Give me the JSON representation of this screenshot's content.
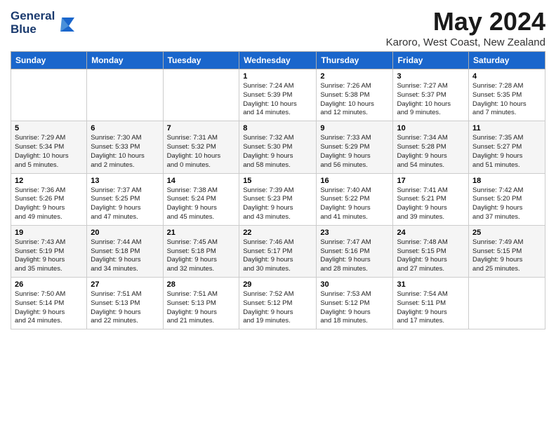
{
  "header": {
    "logo_line1": "General",
    "logo_line2": "Blue",
    "month_title": "May 2024",
    "location": "Karoro, West Coast, New Zealand"
  },
  "days_of_week": [
    "Sunday",
    "Monday",
    "Tuesday",
    "Wednesday",
    "Thursday",
    "Friday",
    "Saturday"
  ],
  "weeks": [
    [
      {
        "day": "",
        "info": ""
      },
      {
        "day": "",
        "info": ""
      },
      {
        "day": "",
        "info": ""
      },
      {
        "day": "1",
        "info": "Sunrise: 7:24 AM\nSunset: 5:39 PM\nDaylight: 10 hours\nand 14 minutes."
      },
      {
        "day": "2",
        "info": "Sunrise: 7:26 AM\nSunset: 5:38 PM\nDaylight: 10 hours\nand 12 minutes."
      },
      {
        "day": "3",
        "info": "Sunrise: 7:27 AM\nSunset: 5:37 PM\nDaylight: 10 hours\nand 9 minutes."
      },
      {
        "day": "4",
        "info": "Sunrise: 7:28 AM\nSunset: 5:35 PM\nDaylight: 10 hours\nand 7 minutes."
      }
    ],
    [
      {
        "day": "5",
        "info": "Sunrise: 7:29 AM\nSunset: 5:34 PM\nDaylight: 10 hours\nand 5 minutes."
      },
      {
        "day": "6",
        "info": "Sunrise: 7:30 AM\nSunset: 5:33 PM\nDaylight: 10 hours\nand 2 minutes."
      },
      {
        "day": "7",
        "info": "Sunrise: 7:31 AM\nSunset: 5:32 PM\nDaylight: 10 hours\nand 0 minutes."
      },
      {
        "day": "8",
        "info": "Sunrise: 7:32 AM\nSunset: 5:30 PM\nDaylight: 9 hours\nand 58 minutes."
      },
      {
        "day": "9",
        "info": "Sunrise: 7:33 AM\nSunset: 5:29 PM\nDaylight: 9 hours\nand 56 minutes."
      },
      {
        "day": "10",
        "info": "Sunrise: 7:34 AM\nSunset: 5:28 PM\nDaylight: 9 hours\nand 54 minutes."
      },
      {
        "day": "11",
        "info": "Sunrise: 7:35 AM\nSunset: 5:27 PM\nDaylight: 9 hours\nand 51 minutes."
      }
    ],
    [
      {
        "day": "12",
        "info": "Sunrise: 7:36 AM\nSunset: 5:26 PM\nDaylight: 9 hours\nand 49 minutes."
      },
      {
        "day": "13",
        "info": "Sunrise: 7:37 AM\nSunset: 5:25 PM\nDaylight: 9 hours\nand 47 minutes."
      },
      {
        "day": "14",
        "info": "Sunrise: 7:38 AM\nSunset: 5:24 PM\nDaylight: 9 hours\nand 45 minutes."
      },
      {
        "day": "15",
        "info": "Sunrise: 7:39 AM\nSunset: 5:23 PM\nDaylight: 9 hours\nand 43 minutes."
      },
      {
        "day": "16",
        "info": "Sunrise: 7:40 AM\nSunset: 5:22 PM\nDaylight: 9 hours\nand 41 minutes."
      },
      {
        "day": "17",
        "info": "Sunrise: 7:41 AM\nSunset: 5:21 PM\nDaylight: 9 hours\nand 39 minutes."
      },
      {
        "day": "18",
        "info": "Sunrise: 7:42 AM\nSunset: 5:20 PM\nDaylight: 9 hours\nand 37 minutes."
      }
    ],
    [
      {
        "day": "19",
        "info": "Sunrise: 7:43 AM\nSunset: 5:19 PM\nDaylight: 9 hours\nand 35 minutes."
      },
      {
        "day": "20",
        "info": "Sunrise: 7:44 AM\nSunset: 5:18 PM\nDaylight: 9 hours\nand 34 minutes."
      },
      {
        "day": "21",
        "info": "Sunrise: 7:45 AM\nSunset: 5:18 PM\nDaylight: 9 hours\nand 32 minutes."
      },
      {
        "day": "22",
        "info": "Sunrise: 7:46 AM\nSunset: 5:17 PM\nDaylight: 9 hours\nand 30 minutes."
      },
      {
        "day": "23",
        "info": "Sunrise: 7:47 AM\nSunset: 5:16 PM\nDaylight: 9 hours\nand 28 minutes."
      },
      {
        "day": "24",
        "info": "Sunrise: 7:48 AM\nSunset: 5:15 PM\nDaylight: 9 hours\nand 27 minutes."
      },
      {
        "day": "25",
        "info": "Sunrise: 7:49 AM\nSunset: 5:15 PM\nDaylight: 9 hours\nand 25 minutes."
      }
    ],
    [
      {
        "day": "26",
        "info": "Sunrise: 7:50 AM\nSunset: 5:14 PM\nDaylight: 9 hours\nand 24 minutes."
      },
      {
        "day": "27",
        "info": "Sunrise: 7:51 AM\nSunset: 5:13 PM\nDaylight: 9 hours\nand 22 minutes."
      },
      {
        "day": "28",
        "info": "Sunrise: 7:51 AM\nSunset: 5:13 PM\nDaylight: 9 hours\nand 21 minutes."
      },
      {
        "day": "29",
        "info": "Sunrise: 7:52 AM\nSunset: 5:12 PM\nDaylight: 9 hours\nand 19 minutes."
      },
      {
        "day": "30",
        "info": "Sunrise: 7:53 AM\nSunset: 5:12 PM\nDaylight: 9 hours\nand 18 minutes."
      },
      {
        "day": "31",
        "info": "Sunrise: 7:54 AM\nSunset: 5:11 PM\nDaylight: 9 hours\nand 17 minutes."
      },
      {
        "day": "",
        "info": ""
      }
    ]
  ]
}
